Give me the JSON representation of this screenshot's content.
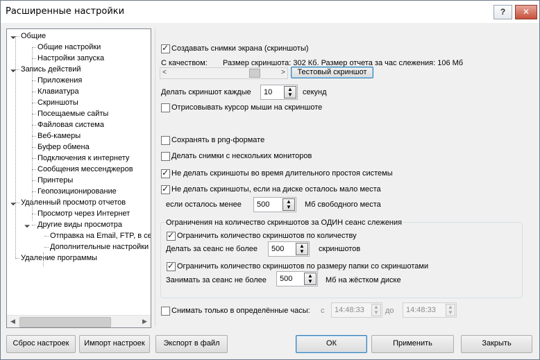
{
  "window": {
    "title": "Расширенные настройки",
    "help_label": "?",
    "close_label": "✕"
  },
  "tree": {
    "items": [
      {
        "label": "Общие",
        "level": 0,
        "expanded": true
      },
      {
        "label": "Общие настройки",
        "level": 1
      },
      {
        "label": "Настройки запуска",
        "level": 1
      },
      {
        "label": "Запись действий",
        "level": 0,
        "expanded": true
      },
      {
        "label": "Приложения",
        "level": 1
      },
      {
        "label": "Клавиатура",
        "level": 1
      },
      {
        "label": "Скриншоты",
        "level": 1
      },
      {
        "label": "Посещаемые сайты",
        "level": 1
      },
      {
        "label": "Файловая система",
        "level": 1
      },
      {
        "label": "Веб-камеры",
        "level": 1
      },
      {
        "label": "Буфер обмена",
        "level": 1
      },
      {
        "label": "Подключения к интернету",
        "level": 1
      },
      {
        "label": "Сообщения мессенджеров",
        "level": 1
      },
      {
        "label": "Принтеры",
        "level": 1
      },
      {
        "label": "Геопозиционирование",
        "level": 1
      },
      {
        "label": "Удаленный просмотр отчетов",
        "level": 0,
        "expanded": true
      },
      {
        "label": "Просмотр через Интернет",
        "level": 1
      },
      {
        "label": "Другие виды просмотра",
        "level": 1,
        "expanded": true
      },
      {
        "label": "Отправка на Email, FTP, в се",
        "level": 2
      },
      {
        "label": "Дополнительные настройки",
        "level": 2
      },
      {
        "label": "Удаление программы",
        "level": 0
      }
    ]
  },
  "settings": {
    "create_screenshots": {
      "label": "Создавать снимки экрана (скриншоты)",
      "checked": true
    },
    "quality_label": "С качеством:",
    "size_info": "Размер скриншота: 302 Кб. Размер отчета за час слежения: 106 Мб",
    "test_screenshot_button": "Тестовый скриншот",
    "interval_label": "Делать скриншот каждые",
    "interval_value": "10",
    "interval_unit": "секунд",
    "draw_cursor": {
      "label": "Отрисовывать курсор мыши на скриншоте",
      "checked": false
    },
    "save_png": {
      "label": "Сохранять в png-формате",
      "checked": false
    },
    "multi_monitor": {
      "label": "Делать снимки с нескольких мониторов",
      "checked": false
    },
    "no_idle": {
      "label": "Не делать скриншоты во время длительного простоя системы",
      "checked": true
    },
    "low_disk": {
      "label": "Не делать скриншоты, если на диске осталось мало места",
      "checked": true
    },
    "low_disk_prefix": "если осталось менее",
    "low_disk_value": "500",
    "low_disk_unit": "Мб свободного места",
    "session_group_title": "Ограничения на количество скриншотов за ОДИН сеанс слежения",
    "limit_count": {
      "label": "Ограничить количество скриншотов по количеству",
      "checked": true
    },
    "limit_count_prefix": "Делать за сеанс не более",
    "limit_count_value": "500",
    "limit_count_unit": "скриншотов",
    "limit_size": {
      "label": "Ограничить количество скриншотов по размеру папки со скриншотами",
      "checked": true
    },
    "limit_size_prefix": "Занимать за сеанс не более",
    "limit_size_value": "500",
    "limit_size_unit": "Мб на жёстком диске",
    "hours_only": {
      "label": "Снимать только в определённые часы:",
      "checked": false
    },
    "from_label": "с",
    "from_value": "14:48:33",
    "to_label": "до",
    "to_value": "14:48:33"
  },
  "buttons": {
    "reset": "Сброс настроек",
    "import": "Импорт настроек",
    "export": "Экспорт в файл",
    "ok": "ОК",
    "apply": "Применить",
    "close": "Закрыть"
  }
}
